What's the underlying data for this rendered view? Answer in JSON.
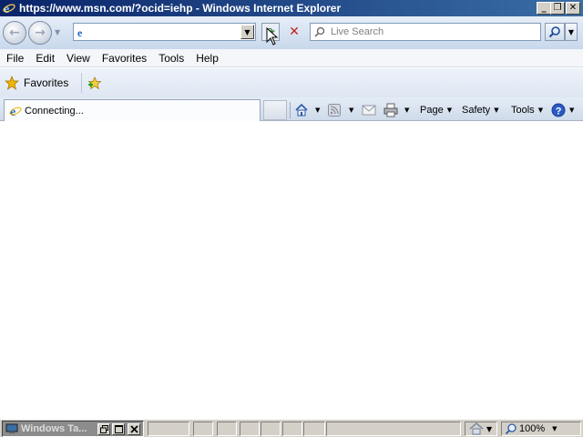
{
  "window": {
    "title": "https://www.msn.com/?ocid=iehp - Windows Internet Explorer",
    "minimize_glyph": "_",
    "restore_glyph": "❐",
    "close_glyph": "✕"
  },
  "nav": {
    "back_glyph": "←",
    "forward_glyph": "→",
    "history_glyph": "▼",
    "address_value": "",
    "address_drop_glyph": "▼",
    "refresh_glyph": "⟳",
    "stop_glyph": "✕",
    "search_placeholder": "Live Search",
    "search_options_glyph": "▼"
  },
  "menu": {
    "items": [
      "File",
      "Edit",
      "View",
      "Favorites",
      "Tools",
      "Help"
    ]
  },
  "favorites_bar": {
    "favorites_label": "Favorites"
  },
  "tab": {
    "label": "Connecting..."
  },
  "command_bar": {
    "page_label": "Page",
    "safety_label": "Safety",
    "tools_label": "Tools",
    "drop_glyph": "▼"
  },
  "statusbar": {
    "task_label": "Windows Ta...",
    "zoom_label": "100%",
    "drop_glyph": "▼"
  },
  "icons": {
    "ie_logo": "ie-logo-icon",
    "star": "favorites-star-icon",
    "add_favorite": "add-favorite-icon",
    "home": "home-icon",
    "feeds": "rss-feed-icon",
    "mail": "mail-icon",
    "print": "printer-icon",
    "help": "help-icon",
    "search": "magnifier-icon",
    "zone": "protected-mode-icon",
    "zoom": "zoom-icon"
  },
  "colors": {
    "titlebar_start": "#0a246a",
    "titlebar_end": "#3a6ea5",
    "ie_blue": "#1a66c8",
    "stop_red": "#c02020",
    "star_gold": "#f0b400"
  }
}
